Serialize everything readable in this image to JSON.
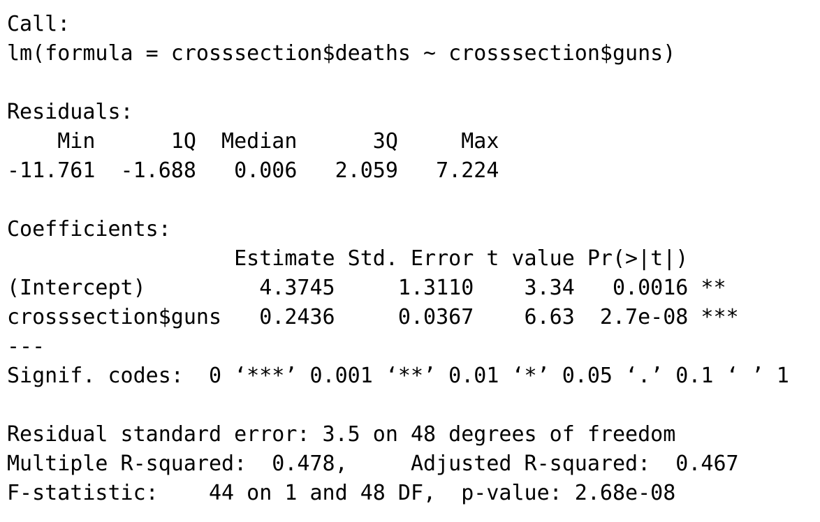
{
  "output": {
    "call_header": "Call:",
    "call_formula": "lm(formula = crosssection$deaths ~ crosssection$guns)",
    "residuals_header": "Residuals:",
    "residuals_labels_row": "    Min      1Q  Median      3Q     Max ",
    "residuals_values_row": "-11.761  -1.688   0.006   2.059   7.224 ",
    "coefficients_header": "Coefficients:",
    "coef_column_header_row": "                  Estimate Std. Error t value Pr(>|t|)    ",
    "coef_intercept_row": "(Intercept)         4.3745     1.3110    3.34   0.0016 ** ",
    "coef_guns_row": "crosssection$guns   0.2436     0.0367    6.63  2.7e-08 ***",
    "separator": "---",
    "signif_codes": "Signif. codes:  0 ‘***’ 0.001 ‘**’ 0.01 ‘*’ 0.05 ‘.’ 0.1 ‘ ’ 1",
    "residual_std_error": "Residual standard error: 3.5 on 48 degrees of freedom",
    "r_squared": "Multiple R-squared:  0.478,\tAdjusted R-squared:  0.467 ",
    "f_statistic": "F-statistic:    44 on 1 and 48 DF,  p-value: 2.68e-08"
  }
}
